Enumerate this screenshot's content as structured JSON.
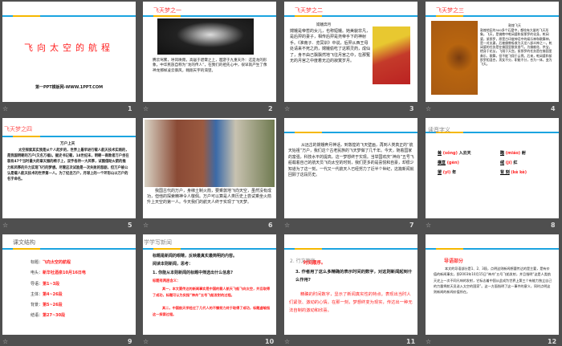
{
  "slides": [
    {
      "n": "1",
      "title": "飞向太空的航程",
      "sub": "第一PPT模板网-WWW.1PPT.COM"
    },
    {
      "n": "2",
      "title": "飞天梦之一",
      "body": "腾云驾雾，呼风唤雨，高居于碧霄之上，遨游于九重天外：这是龙的形象。中华民族自称为“龙的传人”，在我们的祖先心中，很早就产生了像神龙那样凌云御风，翱翔天宇的渴望。"
    },
    {
      "n": "3",
      "title": "飞天梦之二",
      "heading": "嫦娥奔月",
      "body": "嫦娥是帝喾的女儿，也称姮娥。她美貌非凡，是后羿的妻子，相传后羿是尧帝手下的神射手。《淮南子．览冥训》中说，后羿从西王母处请来不死之药，嫦娥偷吃了这颗灵药，成仙了，身不由己飘飘然地飞往月宫之中，在那冤无的月宫之中度着无边的寂寞岁月。"
    },
    {
      "n": "4",
      "title": "飞天梦之三",
      "heading": "敦煌飞天",
      "body": "敦煌地区的500多个石窟中，都绘有大量的飞天形象。飞天，是佛教中乾闼婆和紧那罗的化身。乾闼婆，紧那罗，原是古印度神话中的娱乐神和歌舞神，是一对夫妻，后被佛教吸收为天龙八部众神之一。乾闼婆的任务是在佛国里散发香气，为佛献花、供宝，栖身于花丛，飞翔于天宫。紧那罗的任务是在佛国里奏乐、歌舞，但不能飞翔于云霄。后来，乾闼婆和紧那罗相混合，男女不分，职能不分，合为一体，变为飞天。"
    },
    {
      "n": "5",
      "title": "飞天梦之四",
      "heading": "万户上天",
      "body": "太空探索其实我是从个人起步的，世界上最早进行载人航天技术实践的，是我国明朝的万户(又名万福)。据史书记载，14世纪末，明朝一商敦者万户坐在装有47个当时最大的窜天猴的椅子上，双手各持一大风筝，试图借助火箭的推力和风筝的升力实现飞行的梦想。尽管这次试验是一次失败的悲剧，但万户被公认是载人航天技术的世界第一人。为了纪念万户，月球上的一个环形山以万户的名字命名。"
    },
    {
      "n": "6",
      "body": "我国古代的万户，身绑土制火箭，要乘敦地飞向天空，虽然没有成功，但他的探索精神令人敬佩。万户可以算是人类历史上尝试乘坐火箭升上天空的第一人。今天我们的航天人终于实现了飞天梦。"
    },
    {
      "n": "7",
      "body": "从远古的嫦娥奔月神话，到敦煌的飞天壁画，再到人类真正的“航天始祖”万户，我们这个古老民族的飞天梦做了几千年。今天，随着国家的富强，科技水平的提高，这一梦想终于实现。当举国欢庆“神舟”五号飞船载着自己的航天员飞向太空的时刻，我们更多的是喜悦和自豪，却很少知道为了这一刻，一代又一代航天人已经努力了近半个世纪，这篇新闻就回顾了这段历史。"
    },
    {
      "n": "8",
      "title": "读音字义",
      "words": [
        {
          "w": "耸",
          "p": "(sǒng)",
          "s": "入云天"
        },
        {
          "w": "瞄",
          "p": "(miáo)",
          "s": "射"
        },
        {
          "w": "横亘",
          "p": "(gèn)",
          "s": ""
        },
        {
          "w": "绒",
          "p": "(jí)",
          "s": "红"
        },
        {
          "w": "望",
          "p": "(yī)",
          "s": "年"
        },
        {
          "w": "背 刻",
          "p": "(kè kè)",
          "s": ""
        }
      ]
    },
    {
      "n": "9",
      "title": "课文结构",
      "rows": [
        {
          "k": "标题：",
          "v": "飞向太空的航程"
        },
        {
          "k": "电头：",
          "v": "新华社酒泉10月16日电"
        },
        {
          "k": "导语：",
          "v": "第1~3段"
        },
        {
          "k": "主体：",
          "v": "第4~26段"
        },
        {
          "k": "背景：",
          "v": "第5~26段"
        },
        {
          "k": "结语：",
          "v": "第27~30段"
        }
      ]
    },
    {
      "n": "10",
      "title": "学学写新闻",
      "l1": "标题是新闻的眼睛，反映最真实最简明的内容。",
      "l2": "阅读本则新闻，思考：",
      "q": "1. 你能从本则新闻的标题中筛选出什么信息?",
      "a1": "标题有两层含义：",
      "a2": "其一，本文要传达的新闻事实是中国的载人航天飞船飞向太空，并且取得了成功，标题可认为实指“神舟”五号飞船发射的过程。",
      "a3": "其二，中国航天学经过了几代人的不懈努力终于取得了成功，标题虚喻指这一探索过程。"
    },
    {
      "n": "11",
      "title": "2. 行文顺序",
      "t": "时间顺序。",
      "q": "3. 作者用了这么多精确的表示时间的数字，对这则新闻起到什么作用?",
      "a": "精确的时间数字，显示了新闻真实性的特点。表现出当时人们紧张、激动的心情。在那一刻，梦想终变为现实，传达出一种无法自制的激动和欣喜。"
    },
    {
      "n": "12",
      "title": "导语部分",
      "body": "本文的导语部分是1、2、3段，点明这则新闻想要传达的是主要，是有价值的新闻事实，即2003年10月15日“神舟”五号飞船发射，并且指明“这是人类航天史上一次不同凡响的发射，它标志着中国从此成为世界上第三个有能力独立自己的力量将航天员送入太空的国家”。这一方面指明了这一事件的意义，同时点明这则新闻的新闻价值所在。"
    }
  ]
}
